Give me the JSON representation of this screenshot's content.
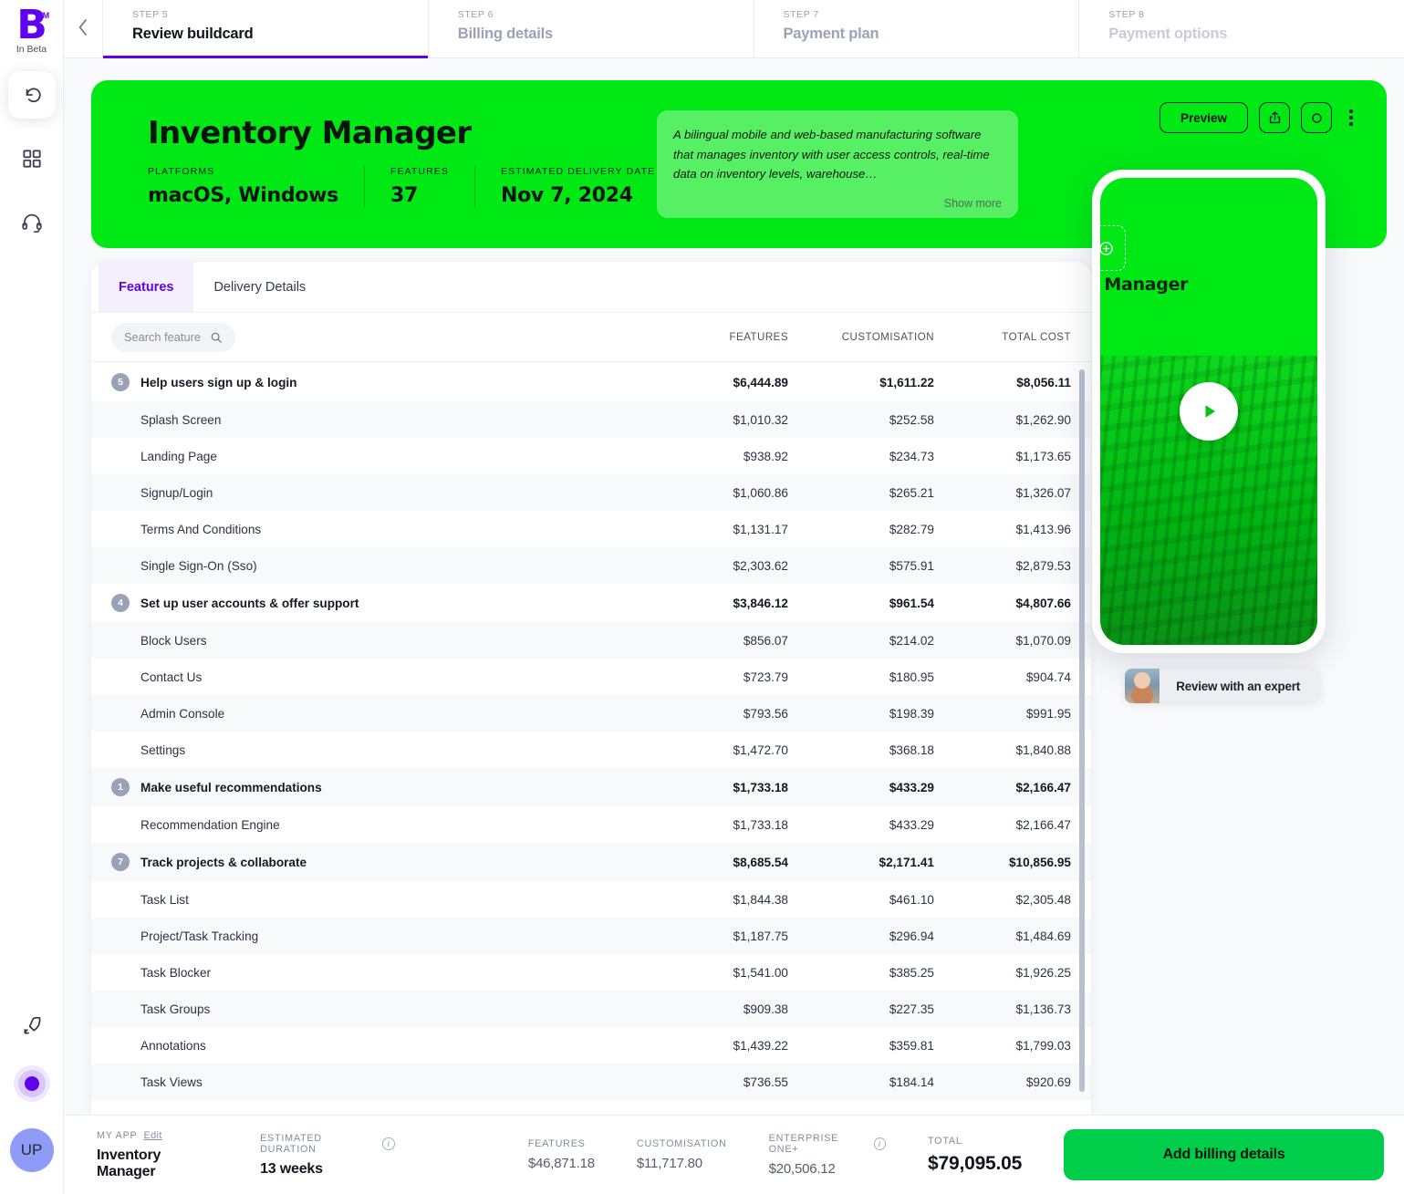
{
  "sidebar": {
    "logo_letter": "B",
    "logo_tm": "TM",
    "logo_sub": "In Beta",
    "items": [
      {
        "name": "undo-icon",
        "label": "Undo"
      },
      {
        "name": "grid-icon",
        "label": "Apps"
      },
      {
        "name": "headset-icon",
        "label": "Support"
      },
      {
        "name": "rocket-icon",
        "label": "Launch"
      }
    ],
    "avatar_initials": "UP"
  },
  "steps": [
    {
      "kicker": "STEP 5",
      "title": "Review buildcard",
      "state": "active"
    },
    {
      "kicker": "STEP 6",
      "title": "Billing details",
      "state": "mid"
    },
    {
      "kicker": "STEP 7",
      "title": "Payment plan",
      "state": "mid"
    },
    {
      "kicker": "STEP 8",
      "title": "Payment options",
      "state": "dim"
    }
  ],
  "hero": {
    "title": "Inventory Manager",
    "stats": [
      {
        "label": "PLATFORMS",
        "value": "macOS, Windows"
      },
      {
        "label": "FEATURES",
        "value": "37"
      },
      {
        "label": "ESTIMATED DELIVERY DATE",
        "value": "Nov 7, 2024"
      }
    ],
    "description": "A bilingual mobile and web-based manufacturing software that manages inventory with user access controls, real-time data on inventory levels, warehouse…",
    "show_more": "Show more",
    "preview_label": "Preview",
    "accent_color": "#00E915",
    "description_bg": "#57F065"
  },
  "card": {
    "tabs": [
      {
        "label": "Features",
        "active": true
      },
      {
        "label": "Delivery Details",
        "active": false
      }
    ],
    "search_placeholder": "Search feature",
    "columns": [
      "FEATURES",
      "CUSTOMISATION",
      "TOTAL COST"
    ],
    "rows": [
      {
        "type": "group",
        "badge": "5",
        "name": "Help users sign up & login",
        "features": "$6,444.89",
        "customisation": "$1,611.22",
        "total": "$8,056.11"
      },
      {
        "type": "item",
        "name": "Splash Screen",
        "features": "$1,010.32",
        "customisation": "$252.58",
        "total": "$1,262.90"
      },
      {
        "type": "item",
        "name": "Landing Page",
        "features": "$938.92",
        "customisation": "$234.73",
        "total": "$1,173.65"
      },
      {
        "type": "item",
        "name": "Signup/Login",
        "features": "$1,060.86",
        "customisation": "$265.21",
        "total": "$1,326.07"
      },
      {
        "type": "item",
        "name": "Terms And Conditions",
        "features": "$1,131.17",
        "customisation": "$282.79",
        "total": "$1,413.96"
      },
      {
        "type": "item",
        "name": "Single Sign-On (Sso)",
        "features": "$2,303.62",
        "customisation": "$575.91",
        "total": "$2,879.53"
      },
      {
        "type": "group",
        "badge": "4",
        "name": "Set up user accounts & offer support",
        "features": "$3,846.12",
        "customisation": "$961.54",
        "total": "$4,807.66"
      },
      {
        "type": "item",
        "name": "Block Users",
        "features": "$856.07",
        "customisation": "$214.02",
        "total": "$1,070.09"
      },
      {
        "type": "item",
        "name": "Contact Us",
        "features": "$723.79",
        "customisation": "$180.95",
        "total": "$904.74"
      },
      {
        "type": "item",
        "name": "Admin Console",
        "features": "$793.56",
        "customisation": "$198.39",
        "total": "$991.95"
      },
      {
        "type": "item",
        "name": "Settings",
        "features": "$1,472.70",
        "customisation": "$368.18",
        "total": "$1,840.88"
      },
      {
        "type": "group",
        "badge": "1",
        "name": "Make useful recommendations",
        "features": "$1,733.18",
        "customisation": "$433.29",
        "total": "$2,166.47"
      },
      {
        "type": "item",
        "name": "Recommendation Engine",
        "features": "$1,733.18",
        "customisation": "$433.29",
        "total": "$2,166.47"
      },
      {
        "type": "group",
        "badge": "7",
        "name": "Track projects & collaborate",
        "features": "$8,685.54",
        "customisation": "$2,171.41",
        "total": "$10,856.95"
      },
      {
        "type": "item",
        "name": "Task List",
        "features": "$1,844.38",
        "customisation": "$461.10",
        "total": "$2,305.48"
      },
      {
        "type": "item",
        "name": "Project/Task Tracking",
        "features": "$1,187.75",
        "customisation": "$296.94",
        "total": "$1,484.69"
      },
      {
        "type": "item",
        "name": "Task Blocker",
        "features": "$1,541.00",
        "customisation": "$385.25",
        "total": "$1,926.25"
      },
      {
        "type": "item",
        "name": "Task Groups",
        "features": "$909.38",
        "customisation": "$227.35",
        "total": "$1,136.73"
      },
      {
        "type": "item",
        "name": "Annotations",
        "features": "$1,439.22",
        "customisation": "$359.81",
        "total": "$1,799.03"
      },
      {
        "type": "item",
        "name": "Task Views",
        "features": "$736.55",
        "customisation": "$184.14",
        "total": "$920.69"
      }
    ]
  },
  "preview": {
    "app_name": "y Manager",
    "expert_label": "Review with an expert"
  },
  "footer": {
    "my_app_label": "MY APP",
    "edit_label": "Edit",
    "app_name": "Inventory Manager",
    "duration_label": "ESTIMATED DURATION",
    "duration_value": "13 weeks",
    "features_label": "FEATURES",
    "features_value": "$46,871.18",
    "customisation_label": "CUSTOMISATION",
    "customisation_value": "$11,717.80",
    "enterprise_label": "ENTERPRISE ONE+",
    "enterprise_value": "$20,506.12",
    "total_label": "TOTAL",
    "total_value": "$79,095.05",
    "cta_label": "Add billing details",
    "cta_color": "#00CE4B"
  }
}
